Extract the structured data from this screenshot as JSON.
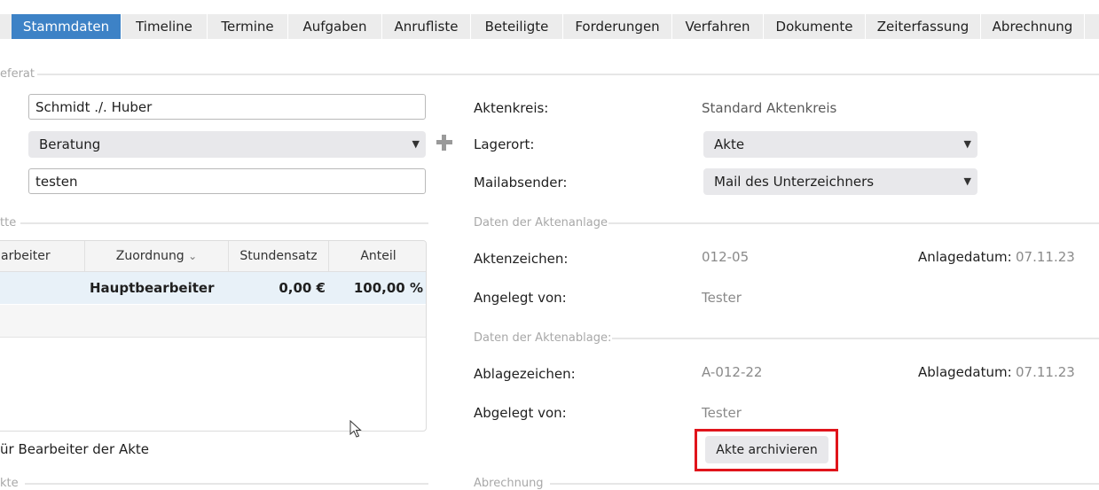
{
  "tabs": [
    {
      "label": "Stammdaten",
      "active": true
    },
    {
      "label": "Timeline"
    },
    {
      "label": "Termine"
    },
    {
      "label": "Aufgaben"
    },
    {
      "label": "Anrufliste"
    },
    {
      "label": "Beteiligte"
    },
    {
      "label": "Forderungen"
    },
    {
      "label": "Verfahren"
    },
    {
      "label": "Dokumente"
    },
    {
      "label": "Zeiterfassung"
    },
    {
      "label": "Abrechnung"
    }
  ],
  "left": {
    "section_referat": "eferat",
    "name_value": "Schmidt ./. Huber",
    "type_select": "Beratung",
    "note_value": "testen",
    "section_akte": "tte",
    "table": {
      "headers": [
        "arbeiter",
        "Zuordnung",
        "Stundensatz",
        "Anteil"
      ],
      "row": {
        "zuordnung": "Hauptbearbeiter",
        "stundensatz": "0,00 €",
        "anteil": "100,00 %"
      }
    },
    "bearbeiter_note": "ür Bearbeiter der Akte",
    "section_bottom": "kte"
  },
  "right": {
    "aktenkreis_label": "Aktenkreis:",
    "aktenkreis_value": "Standard Aktenkreis",
    "lagerort_label": "Lagerort:",
    "lagerort_value": "Akte",
    "mailabsender_label": "Mailabsender:",
    "mailabsender_value": "Mail des Unterzeichners",
    "section_anlage": "Daten der Aktenanlage",
    "aktenzeichen_label": "Aktenzeichen:",
    "aktenzeichen_value": "012-05",
    "anlagedatum_label": "Anlagedatum:",
    "anlagedatum_value": "07.11.23",
    "angelegt_label": "Angelegt von:",
    "angelegt_value": "Tester",
    "section_ablage": "Daten der Aktenablage:",
    "ablagezeichen_label": "Ablagezeichen:",
    "ablagezeichen_value": "A-012-22",
    "ablagedatum_label": "Ablagedatum:",
    "ablagedatum_value": "07.11.23",
    "abgelegt_label": "Abgelegt von:",
    "abgelegt_value": "Tester",
    "archive_button": "Akte archivieren",
    "section_abrechnung": "Abrechnung"
  },
  "icons": {
    "plus": "plus-icon",
    "caret": "caret-down-icon",
    "sort": "chevron-down-icon",
    "cursor": "mouse-pointer-icon"
  },
  "colors": {
    "accent": "#3d82c6",
    "highlight": "#e0141b"
  }
}
